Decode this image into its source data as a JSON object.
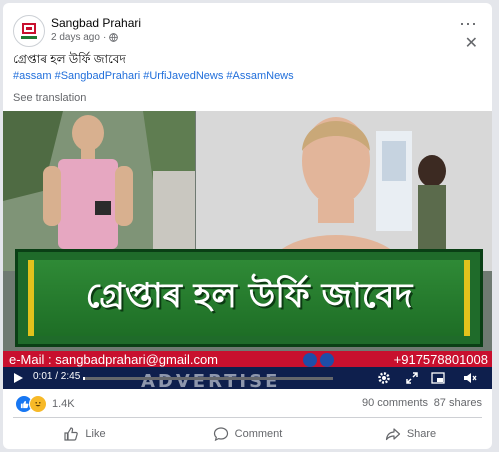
{
  "post": {
    "page_name": "Sangbad Prahari",
    "timestamp": "2 days ago",
    "separator": "·",
    "text": "গ্ৰেপ্তাৰ হল উৰ্ফি জাবেদ",
    "hashtags": "#assam #SangbadPrahari #UrfiJavedNews #AssamNews",
    "see_translation": "See translation",
    "more_icon": "⋯",
    "close_icon": "✕"
  },
  "video": {
    "banner_text": "গ্ৰেপ্তাৰ হল উৰ্ফি জাবেদ",
    "email": "e-Mail : sangbadprahari@gmail.com",
    "phone": "+917578801008",
    "advertise_text": "ADVERTISE",
    "time": "0:01 / 2:45",
    "progress": 0.006
  },
  "stats": {
    "reactions_count": "1.4K",
    "comments": "90 comments",
    "shares": "87 shares"
  },
  "actions": {
    "like": "Like",
    "comment": "Comment",
    "share": "Share"
  },
  "colors": {
    "link": "#216fdb",
    "banner_green": "#1f6b2a",
    "banner_border": "#e2c21c",
    "contact_red": "#c8102e",
    "controls_bg": "#0e1f4d"
  }
}
